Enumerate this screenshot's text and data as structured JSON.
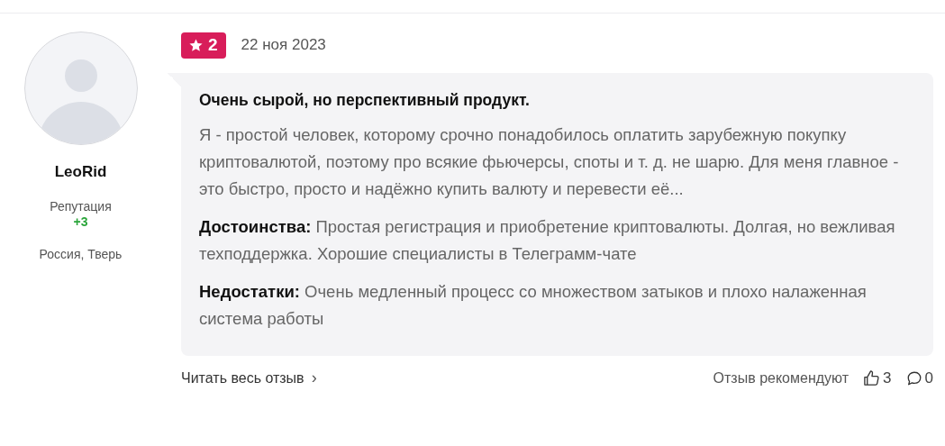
{
  "author": {
    "name": "LeoRid",
    "reputation_label": "Репутация",
    "reputation_value": "+3",
    "location": "Россия, Тверь"
  },
  "review": {
    "rating": "2",
    "date": "22 ноя 2023",
    "title": "Очень сырой, но перспективный продукт.",
    "text": "Я - простой человек, которому срочно понадобилось оплатить зарубежную покупку криптовалютой, поэтому про всякие фьючерсы, споты и т. д. не шарю. Для меня главное - это быстро, просто и надёжно купить валюту и перевести её...",
    "pros": "**Достоинства:** Простая регистрация и приобретение криптовалюты. Долгая, но вежливая техподдержка. Хорошие специалисты в Телеграмм-чате",
    "cons": "**Недостатки:** Очень медленный процесс со множеством затыков и плохо налаженная система работы"
  },
  "footer": {
    "read_more": "Читать весь отзыв",
    "caret": "›",
    "recommend_label": "Отзыв рекомендуют",
    "likes": "3",
    "comments": "0"
  }
}
